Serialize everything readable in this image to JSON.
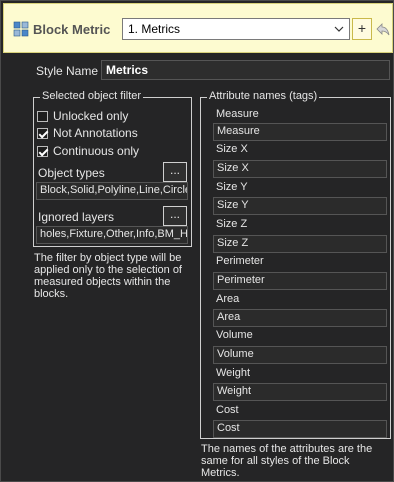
{
  "header": {
    "title": "Block Metric",
    "style_select_value": "1. Metrics",
    "add_label": "+",
    "icon": "block-metric-icon",
    "back_icon": "back-arrow-icon",
    "accent": "#fdfbd0"
  },
  "style_name": {
    "label": "Style Name",
    "value": "Metrics"
  },
  "filter": {
    "legend": "Selected object filter",
    "checkboxes": [
      {
        "label": "Unlocked only",
        "checked": false
      },
      {
        "label": "Not Annotations",
        "checked": true
      },
      {
        "label": "Continuous only",
        "checked": true
      }
    ],
    "object_types_label": "Object types",
    "object_types_value": "Block,Solid,Polyline,Line,Circle,A",
    "ignored_layers_label": "Ignored layers",
    "ignored_layers_value": "holes,Fixture,Other,Info,BM_Hid",
    "dots_label": "...",
    "note": "The filter by object type will be applied only to the selection of measured objects within the blocks."
  },
  "attributes": {
    "legend": "Attribute names (tags)",
    "items": [
      {
        "label": "Measure",
        "value": "Measure"
      },
      {
        "label": "Size X",
        "value": "Size X"
      },
      {
        "label": "Size Y",
        "value": "Size Y"
      },
      {
        "label": "Size Z",
        "value": "Size Z"
      },
      {
        "label": "Perimeter",
        "value": "Perimeter"
      },
      {
        "label": "Area",
        "value": "Area"
      },
      {
        "label": "Volume",
        "value": "Volume"
      },
      {
        "label": "Weight",
        "value": "Weight"
      },
      {
        "label": "Cost",
        "value": "Cost"
      }
    ],
    "note": "The names of the attributes are the same for all styles of the Block Metrics."
  }
}
